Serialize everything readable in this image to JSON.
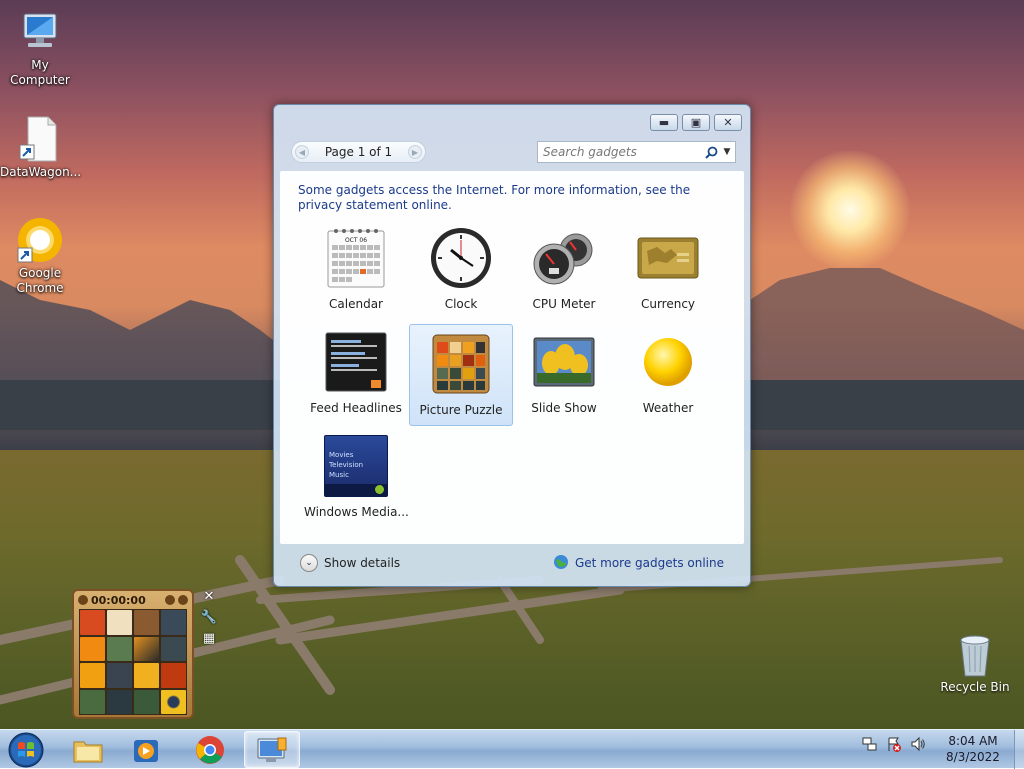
{
  "desktop": {
    "icons": [
      {
        "label": "My Computer",
        "icon": "computer-icon"
      },
      {
        "label": "DataWagon...",
        "icon": "file-shortcut-icon"
      },
      {
        "label": "Google Chrome",
        "icon": "chrome-icon"
      },
      {
        "label": "Recycle Bin",
        "icon": "recycle-bin-icon"
      }
    ]
  },
  "gallery": {
    "window_buttons": {
      "minimize": "minimize",
      "restore": "restore",
      "close": "close"
    },
    "pager": {
      "text": "Page 1 of 1"
    },
    "search": {
      "placeholder": "Search gadgets"
    },
    "notice": "Some gadgets access the Internet.  For more information, see the privacy statement online.",
    "gadgets": [
      {
        "label": "Calendar",
        "icon": "calendar-icon",
        "selected": false
      },
      {
        "label": "Clock",
        "icon": "clock-icon",
        "selected": false
      },
      {
        "label": "CPU Meter",
        "icon": "cpu-meter-icon",
        "selected": false
      },
      {
        "label": "Currency",
        "icon": "currency-icon",
        "selected": false
      },
      {
        "label": "Feed Headlines",
        "icon": "feed-headlines-icon",
        "selected": false
      },
      {
        "label": "Picture Puzzle",
        "icon": "picture-puzzle-icon",
        "selected": true
      },
      {
        "label": "Slide Show",
        "icon": "slide-show-icon",
        "selected": false
      },
      {
        "label": "Weather",
        "icon": "weather-icon",
        "selected": false
      },
      {
        "label": "Windows Media...",
        "icon": "windows-media-icon",
        "selected": false
      }
    ],
    "calendar_month": "OCT 06",
    "media_menu": [
      "Movies",
      "Television",
      "Music"
    ],
    "show_details": "Show details",
    "get_more": "Get more gadgets online"
  },
  "puzzle_gadget": {
    "time": "00:00:00"
  },
  "taskbar": {
    "clock_time": "8:04 AM",
    "clock_date": "8/3/2022",
    "pinned": [
      "start-orb-icon",
      "explorer-folder-icon",
      "media-player-icon",
      "chrome-icon",
      "gadget-gallery-icon"
    ]
  },
  "colors": {
    "taskbar": "#9fbcdd",
    "link": "#1a3a8a",
    "selection": "#cfe3f8"
  }
}
